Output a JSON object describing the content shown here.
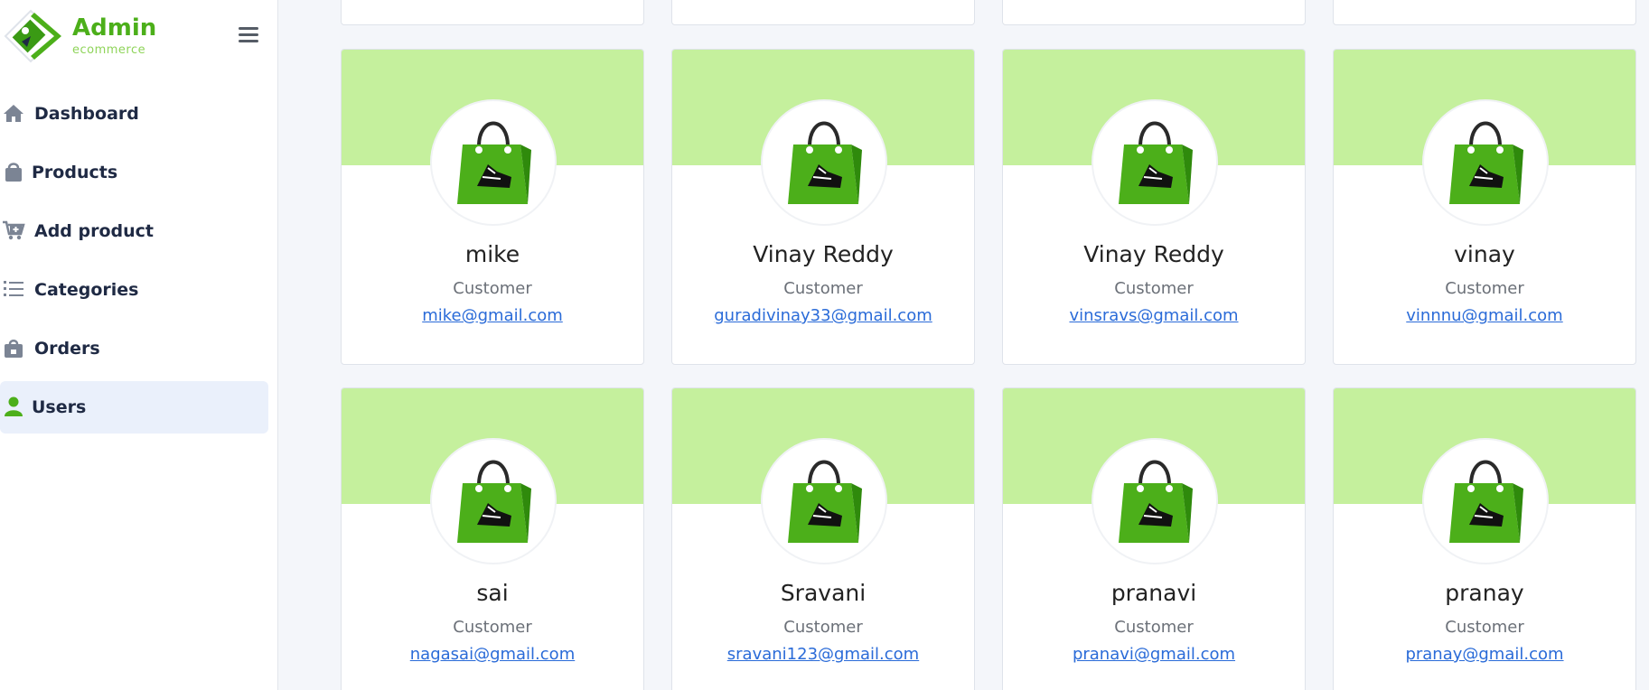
{
  "brand": {
    "title": "Admin",
    "subtitle": "ecommerce",
    "accent": "#4caf1a",
    "logo_icon": "tag-logo-icon"
  },
  "sidebar": {
    "menu_icon": "hamburger-icon",
    "items": [
      {
        "label": "Dashboard",
        "icon": "home-icon",
        "active": false
      },
      {
        "label": "Products",
        "icon": "shopping-bag-icon",
        "active": false
      },
      {
        "label": "Add product",
        "icon": "cart-plus-icon",
        "active": false
      },
      {
        "label": "Categories",
        "icon": "list-icon",
        "active": false
      },
      {
        "label": "Orders",
        "icon": "orders-bag-icon",
        "active": false
      },
      {
        "label": "Users",
        "icon": "user-icon",
        "active": true
      }
    ]
  },
  "users": [
    {
      "name": "mike",
      "role": "Customer",
      "email": "mike@gmail.com"
    },
    {
      "name": "Vinay Reddy",
      "role": "Customer",
      "email": "guradivinay33@gmail.com"
    },
    {
      "name": "Vinay Reddy",
      "role": "Customer",
      "email": "vinsravs@gmail.com"
    },
    {
      "name": "vinay",
      "role": "Customer",
      "email": "vinnnu@gmail.com"
    },
    {
      "name": "sai",
      "role": "Customer",
      "email": "nagasai@gmail.com"
    },
    {
      "name": "Sravani",
      "role": "Customer",
      "email": "sravani123@gmail.com"
    },
    {
      "name": "pranavi",
      "role": "Customer",
      "email": "pranavi@gmail.com"
    },
    {
      "name": "pranay",
      "role": "Customer",
      "email": "pranay@gmail.com"
    }
  ],
  "colors": {
    "banner": "#c5f09d",
    "bag": "#4caf1a",
    "active_nav": "#eaf0fb"
  }
}
